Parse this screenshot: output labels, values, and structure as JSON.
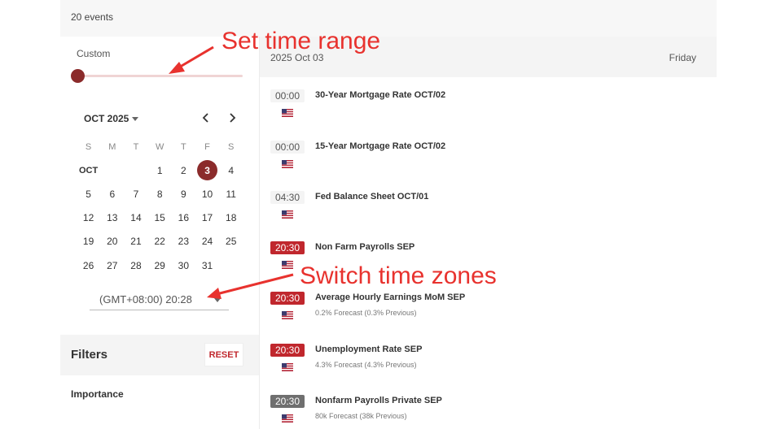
{
  "events_count": "20 events",
  "sidebar": {
    "range_label": "Custom",
    "calendar": {
      "month_label": "OCT 2025",
      "weekdays": [
        "S",
        "M",
        "T",
        "W",
        "T",
        "F",
        "S"
      ],
      "month_tag": "OCT",
      "weeks": [
        [
          "",
          "",
          "",
          "1",
          "2",
          "3",
          "4"
        ],
        [
          "5",
          "6",
          "7",
          "8",
          "9",
          "10",
          "11"
        ],
        [
          "12",
          "13",
          "14",
          "15",
          "16",
          "17",
          "18"
        ],
        [
          "19",
          "20",
          "21",
          "22",
          "23",
          "24",
          "25"
        ],
        [
          "26",
          "27",
          "28",
          "29",
          "30",
          "31",
          ""
        ]
      ],
      "selected_day": "3"
    },
    "timezone": "(GMT+08:00) 20:28",
    "filters_title": "Filters",
    "reset_label": "RESET",
    "importance_label": "Importance"
  },
  "main": {
    "date": "2025 Oct 03",
    "weekday": "Friday",
    "events": [
      {
        "time": "00:00",
        "style": "normal",
        "title": "30-Year Mortgage Rate OCT/02",
        "sub": ""
      },
      {
        "time": "00:00",
        "style": "normal",
        "title": "15-Year Mortgage Rate OCT/02",
        "sub": ""
      },
      {
        "time": "04:30",
        "style": "normal",
        "title": "Fed Balance Sheet OCT/01",
        "sub": ""
      },
      {
        "time": "20:30",
        "style": "red",
        "title": "Non Farm Payrolls SEP",
        "sub": ""
      },
      {
        "time": "20:30",
        "style": "red",
        "title": "Average Hourly Earnings MoM SEP",
        "sub": "0.2% Forecast (0.3% Previous)"
      },
      {
        "time": "20:30",
        "style": "red",
        "title": "Unemployment Rate SEP",
        "sub": "4.3% Forecast (4.3% Previous)"
      },
      {
        "time": "20:30",
        "style": "grey",
        "title": "Nonfarm Payrolls Private SEP",
        "sub": "80k Forecast (38k Previous)"
      }
    ]
  },
  "annotations": {
    "set_time_range": "Set time range",
    "switch_time_zones": "Switch time zones"
  },
  "colors": {
    "accent": "#8b2b2b",
    "high_importance": "#c0272d",
    "annotation": "#e8322e"
  },
  "icons": {
    "prev": "chevron-left-icon",
    "next": "chevron-right-icon",
    "flag": "us-flag-icon"
  }
}
